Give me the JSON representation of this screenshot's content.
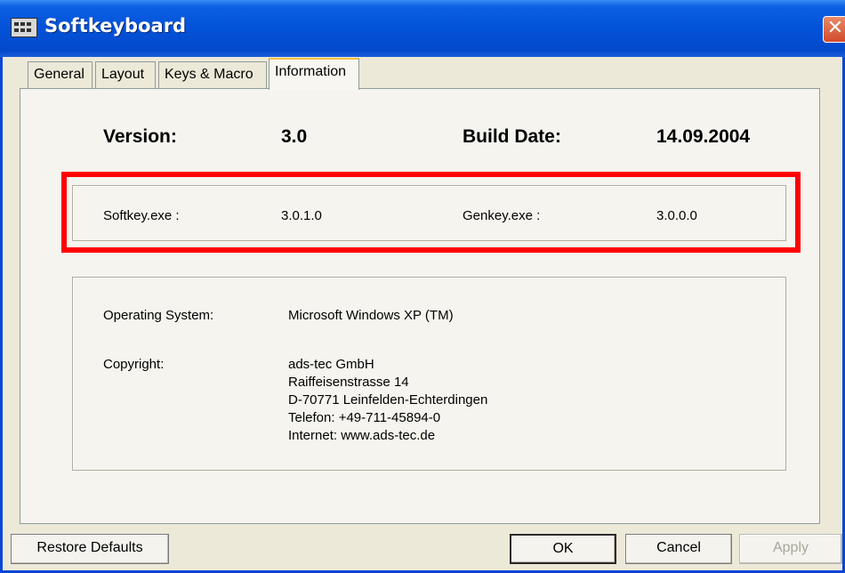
{
  "window": {
    "title": "Softkeyboard",
    "icon": "keyboard-icon",
    "close_glyph": "✕"
  },
  "tabs": [
    {
      "label": "General",
      "active": false
    },
    {
      "label": "Layout",
      "active": false
    },
    {
      "label": "Keys & Macro",
      "active": false
    },
    {
      "label": "Information",
      "active": true
    }
  ],
  "version": {
    "label": "Version:",
    "value": "3.0"
  },
  "build": {
    "label": "Build Date:",
    "value": "14.09.2004"
  },
  "modules": {
    "softkey_label": "Softkey.exe :",
    "softkey_value": "3.0.1.0",
    "genkey_label": "Genkey.exe :",
    "genkey_value": "3.0.0.0"
  },
  "system": {
    "os_label": "Operating System:",
    "os_value": "Microsoft  Windows XP (TM)",
    "copyright_label": "Copyright:",
    "copyright_lines": [
      "ads-tec GmbH",
      "Raiffeisenstrasse 14",
      "D-70771 Leinfelden-Echterdingen",
      "Telefon: +49-711-45894-0",
      "Internet: www.ads-tec.de"
    ]
  },
  "buttons": {
    "restore": "Restore Defaults",
    "ok": "OK",
    "cancel": "Cancel",
    "apply": "Apply"
  },
  "colors": {
    "titlebar": "#0352d8",
    "highlight": "#ff0000",
    "dialog_bg": "#ece9d8"
  }
}
